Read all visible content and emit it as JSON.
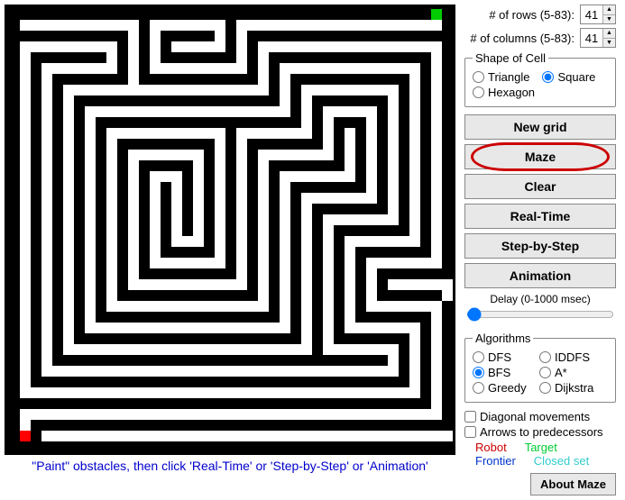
{
  "grid": {
    "rows": 41,
    "cols": 41,
    "rows_label": "# of rows (5-83):",
    "cols_label": "# of columns (5-83):",
    "rows_value": "41",
    "cols_value": "41"
  },
  "shape": {
    "legend": "Shape of Cell",
    "triangle": "Triangle",
    "square": "Square",
    "hexagon": "Hexagon",
    "selected": "square"
  },
  "buttons": {
    "new_grid": "New grid",
    "maze": "Maze",
    "clear": "Clear",
    "real_time": "Real-Time",
    "step_by_step": "Step-by-Step",
    "animation": "Animation",
    "about_maze": "About Maze",
    "highlighted": "maze"
  },
  "delay": {
    "label": "Delay (0-1000 msec)",
    "value": 10,
    "min": 0,
    "max": 1000
  },
  "algorithms": {
    "legend": "Algorithms",
    "dfs": "DFS",
    "iddfs": "IDDFS",
    "bfs": "BFS",
    "astar": "A*",
    "greedy": "Greedy",
    "dijkstra": "Dijkstra",
    "selected": "bfs"
  },
  "checks": {
    "diagonal": "Diagonal movements",
    "arrows": "Arrows to predecessors",
    "diagonal_checked": false,
    "arrows_checked": false
  },
  "legend_colors": {
    "robot": "Robot",
    "target": "Target",
    "frontier": "Frontier",
    "closed": "Closed set"
  },
  "status": "\"Paint\" obstacles, then click 'Real-Time' or 'Step-by-Step' or 'Animation'",
  "maze_cells": [
    "wwwwwwwwwwwwwwwwwwwwwwwwwwwwwwwwwwwwwwwtw",
    "wooooooooooowooooooowooooooooooooooooooow",
    "wwwwwwwwwwwowowwwwwowowwwwwwwwwwwwwwwwwww",
    "wooooooooowowowooooowowooooooooooooooooow",
    "wowwwwwwwowowowwwwwwwowowwwwwwwwwwwwwwwow",
    "wowooooooowowooooooooowowooooooooooooowow",
    "wowowwwwwwwowwwwwwwwwwwowowwwwwwwwwwwowow",
    "wowowooooooooooooooooooowowooooooooowowow",
    "wowowowwwwwwwwwwwwwwwwwwwowowwwwwwwowowow",
    "wowowowooooooooooooooooooowowooooowowowow",
    "wowowowowwwwwwwwwwwwwwwwwwwowowwwowowowow",
    "wowowowowooooooooooowooooooowowowowowowow",
    "wowowowowowwwwwwwwwowowwwwwwwowowowowowow",
    "wowowowowowooooooowowowooooooowowowowowow",
    "wowowowowowowwwwwowowowowwwwwwwowowowowow",
    "wowowowowowowooowowowowowooooooowowowowow",
    "wowowowowowowowowowowowowowwwwwwwowowowow",
    "wowowowowowowowowowowowowowooooooowowowow",
    "wowowowowowowowowowowowowowowwwwwwwowowow",
    "wowowowowowowowowowowowowowowooooooowowow",
    "wowowowowowowowowowowowowowowowwwwwwwowow",
    "wowowowowowowowooowowowowowowowooooooowow",
    "wowowowowowowowwwwwowowowowowowowwwwwwwow",
    "wowowowowowowooooooowowowowowowowooooooow",
    "wowowowowowowwwwwwwwwowowowowowowowwwwwww",
    "wowowowowowooooooooooowowowowowowowoooooow",
    "wowowowowowwwwwwwwwwwwwowowowowowowwwwwwow",
    "wowowowowooooooooooooooowowowowowooooooowow",
    "wowowowowwwwwwwwwwwwwwwwwowowowowwwwwwwowow",
    "wowowowooooooooooooooooooowowowooooooowowow",
    "wowowowwwwwwwwwwwwwwwwwwwwwowowwwwwwwowowow",
    "wowowooooooooooooooooooooooowooooooowowowow",
    "wowowwwwwwwwwwwwwwwwwwwwwwwwwwwwwwwowowowow",
    "wowooooooooooooooooooooooooooooooooowowowow",
    "wowwwwwwwwwwwwwwwwwwwwwwwwwwwwwwwwwwwowowow",
    "wooooooooooooooooooooooooooooooooooooowowow",
    "wwwwwwwwwwwwwwwwwwwwwwwwwwwwwwwwwwwwwwwowow",
    "wooooooooooooooooooooooooooooooooooooooowow",
    "wowwwwwwwwwwwwwwwwwwwwwwwwwwwwwwwwwwwwwwwow",
    "wrwooooooooooooooooooooooooooooooooooooooow",
    "wwwwwwwwwwwwwwwwwwwwwwwwwwwwwwwwwwwwwwwwwww"
  ]
}
